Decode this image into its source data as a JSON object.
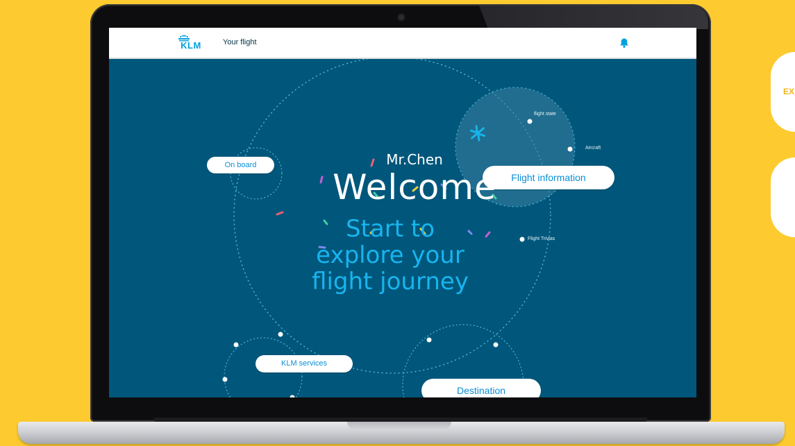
{
  "header": {
    "logo_text": "KLM",
    "title": "Your flight"
  },
  "main": {
    "greeting": "Mr.Chen",
    "headline": "Welcome",
    "tagline_line1": "Start to",
    "tagline_line2": "explore your",
    "tagline_line3": "flight journey"
  },
  "nav": {
    "on_board": "On board",
    "flight_information": "Flight information",
    "klm_services": "KLM services",
    "destination": "Destination"
  },
  "flight_info_subitems": {
    "flight_state": "flight state",
    "aircraft": "Aircraft",
    "flight_trivias": "Flight Trivias"
  },
  "side_panel": {
    "card_text": "EX"
  },
  "colors": {
    "background": "#fdcb2f",
    "screen": "#00577b",
    "accent": "#18b4ee",
    "pill_text": "#0a8fd6"
  },
  "icons": [
    "klm-crown-icon",
    "bell-icon",
    "airplane-icon"
  ]
}
